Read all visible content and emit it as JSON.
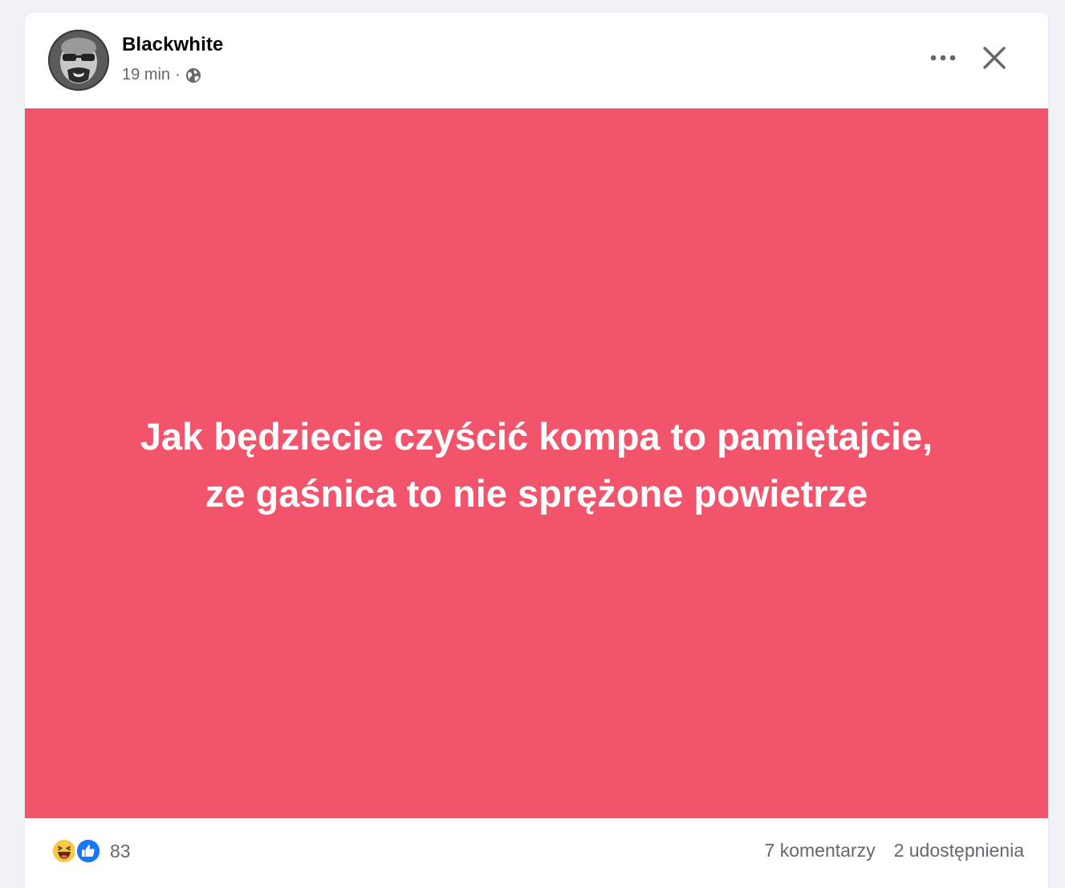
{
  "post": {
    "author": "Blackwhite",
    "time": "19 min",
    "separator": "·",
    "audience_icon": "globe-icon",
    "text_line1": "Jak będziecie czyścić kompa to pamiętajcie,",
    "text_line2": "ze gaśnica to nie sprężone powietrze",
    "background_color": "#f2546b",
    "text_color": "#ffffff"
  },
  "header_actions": {
    "more_icon": "more-horizontal-icon",
    "close_icon": "close-icon"
  },
  "footer": {
    "reaction_icons": [
      "haha-reaction-icon",
      "like-reaction-icon"
    ],
    "reaction_count": "83",
    "comments": "7 komentarzy",
    "shares": "2 udostępnienia"
  }
}
